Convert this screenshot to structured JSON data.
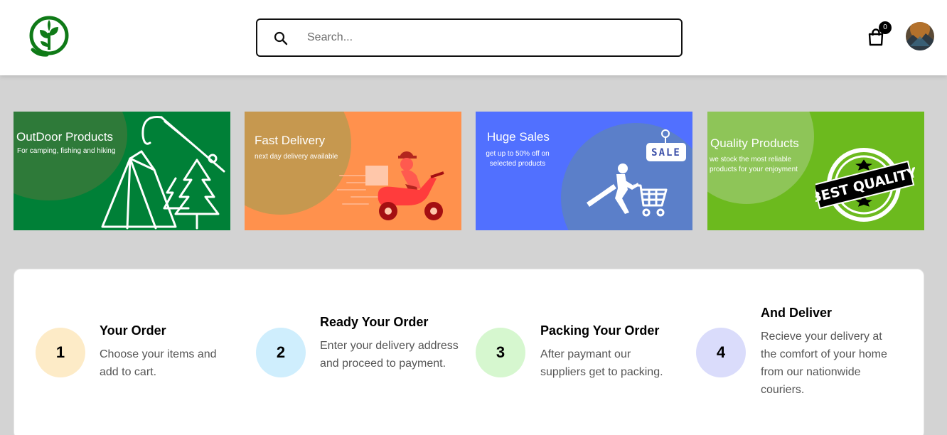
{
  "header": {
    "logo_icon": "sprout-leaf-logo-icon",
    "search": {
      "placeholder": "Search...",
      "value": "",
      "icon": "search-icon"
    },
    "cart": {
      "icon": "shopping-bag-icon",
      "count": "0"
    },
    "avatar": "user-avatar"
  },
  "banners": [
    {
      "title": "OutDoor Products",
      "subtitle": "For camping, fishing and hiking",
      "bg": "#008037",
      "blob": "#2e7a39",
      "art": "tent-fishing-rod-tree-icon"
    },
    {
      "title": "Fast Delivery",
      "subtitle": "next day delivery available",
      "bg": "#ff914d",
      "blob": "#c6984f",
      "art": "delivery-scooter-icon"
    },
    {
      "title": "Huge Sales",
      "subtitle": "get up to 50% off on selected products",
      "sale_tag": "SALE",
      "bg": "#5170ff",
      "blob": "#5b7fc9",
      "art": "shopper-cart-sale-icon"
    },
    {
      "title": "Quality Products",
      "subtitle": "we stock the most reliable products for your enjoyment",
      "stamp": "BEST QUALITY",
      "bg": "#6cba1e",
      "blob": "#8ec558",
      "art": "best-quality-stamp-icon"
    }
  ],
  "steps": [
    {
      "number": "1",
      "title": "Your Order",
      "description": "Choose your items and add to cart.",
      "circle_color": "#fdebc7"
    },
    {
      "number": "2",
      "title": "Ready Your Order",
      "description": "Enter your delivery address and proceed to payment.",
      "circle_color": "#cfeefd"
    },
    {
      "number": "3",
      "title": "Packing Your Order",
      "description": "After paymant our suppliers get to packing.",
      "circle_color": "#d6f7cf"
    },
    {
      "number": "4",
      "title": "And Deliver",
      "description": "Recieve your delivery at the comfort of your home from our nationwide couriers.",
      "circle_color": "#dadcfb"
    }
  ]
}
